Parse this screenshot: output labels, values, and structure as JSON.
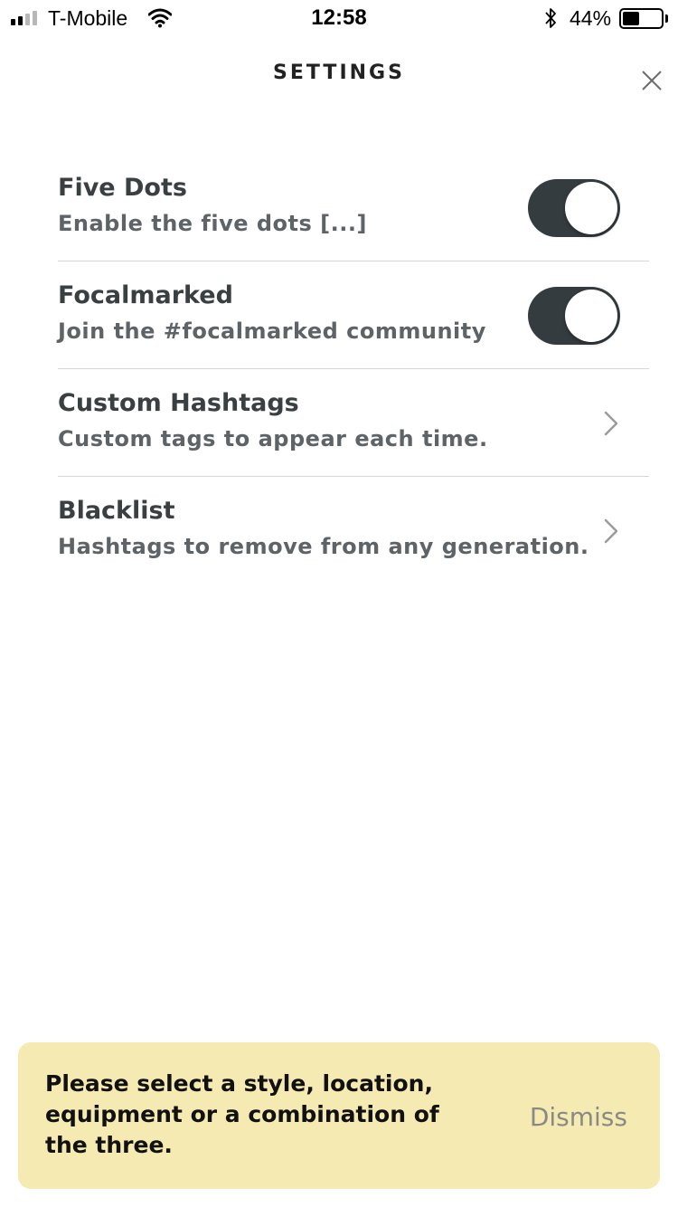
{
  "status_bar": {
    "carrier": "T-Mobile",
    "time": "12:58",
    "battery_percent": "44%",
    "battery_level": 0.44,
    "icons": [
      "signal-icon",
      "wifi-icon",
      "bluetooth-icon",
      "battery-icon"
    ]
  },
  "header": {
    "title": "SETTINGS",
    "close_icon": "close-icon"
  },
  "settings": {
    "items": [
      {
        "title": "Five Dots",
        "subtitle": "Enable the five dots [...]",
        "control": "toggle",
        "enabled": true
      },
      {
        "title": "Focalmarked",
        "subtitle": "Join the #focalmarked community",
        "control": "toggle",
        "enabled": true
      },
      {
        "title": "Custom Hashtags",
        "subtitle": "Custom tags to appear each time.",
        "control": "chevron"
      },
      {
        "title": "Blacklist",
        "subtitle": "Hashtags to remove from any generation.",
        "control": "chevron"
      }
    ]
  },
  "toast": {
    "message": "Please select a style, location, equipment or a combination of the three.",
    "dismiss_label": "Dismiss"
  },
  "colors": {
    "toggle_on": "#353c40",
    "toast_background": "#f5eab1",
    "divider": "#d7d7d7",
    "title_text": "#3a3f42"
  }
}
